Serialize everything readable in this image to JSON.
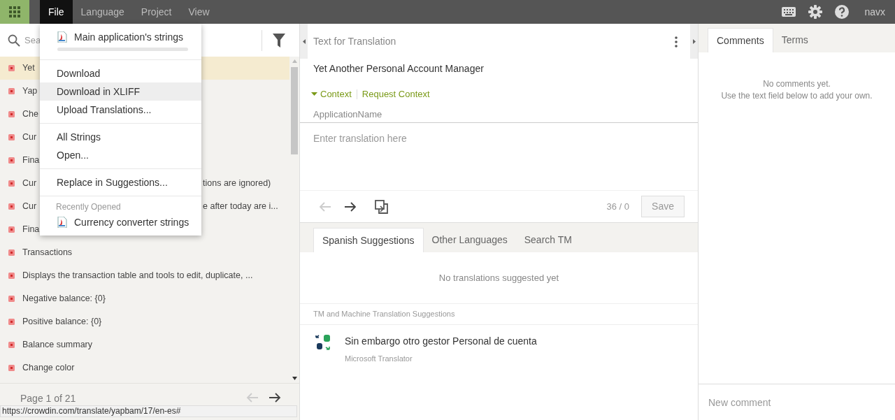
{
  "topbar": {
    "menus": [
      {
        "label": "File",
        "selected": true
      },
      {
        "label": "Language",
        "selected": false
      },
      {
        "label": "Project",
        "selected": false
      },
      {
        "label": "View",
        "selected": false
      }
    ],
    "user": "navx"
  },
  "file_menu": {
    "sections": [
      {
        "items": [
          {
            "kind": "file",
            "label": "Main application's strings",
            "level": 0
          }
        ]
      },
      {
        "items": [
          {
            "kind": "action",
            "label": "Download",
            "highlighted": false
          },
          {
            "kind": "action",
            "label": "Download in XLIFF",
            "highlighted": true
          },
          {
            "kind": "action",
            "label": "Upload Translations...",
            "highlighted": false
          }
        ]
      },
      {
        "items": [
          {
            "kind": "action",
            "label": "All Strings",
            "highlighted": false
          },
          {
            "kind": "action",
            "label": "Open...",
            "highlighted": false
          }
        ]
      },
      {
        "items": [
          {
            "kind": "action",
            "label": "Replace in Suggestions...",
            "highlighted": false
          }
        ]
      },
      {
        "items": [
          {
            "kind": "label",
            "label": "Recently Opened"
          },
          {
            "kind": "file",
            "label": "Currency converter strings"
          }
        ]
      }
    ]
  },
  "strings_panel": {
    "search": {
      "placeholder": "Sea"
    },
    "rows": [
      {
        "text": "Yet",
        "selected": true
      },
      {
        "text": "Yap",
        "selected": false
      },
      {
        "text": "Che",
        "selected": false
      },
      {
        "text": "Cur",
        "selected": false
      },
      {
        "text": "Fina",
        "selected": false
      },
      {
        "text": "Cur",
        "tail": "tions are ignored)",
        "selected": false
      },
      {
        "text": "Cur",
        "tail": "e after today are i...",
        "selected": false
      },
      {
        "text": "Fina",
        "selected": false
      },
      {
        "text": "Transactions",
        "selected": false
      },
      {
        "text": "Displays the transaction table and tools to edit, duplicate, ...",
        "selected": false
      },
      {
        "text": "Negative balance: {0}",
        "selected": false
      },
      {
        "text": "Positive balance: {0}",
        "selected": false
      },
      {
        "text": "Balance summary",
        "selected": false
      },
      {
        "text": "Change color",
        "selected": false
      }
    ],
    "pagination": "Page 1 of 21"
  },
  "editor": {
    "header": "Text for Translation",
    "source": "Yet Another Personal Account Manager",
    "context_toggle": "Context",
    "request_context": "Request Context",
    "context": "ApplicationName",
    "translation": {
      "placeholder": "Enter translation here"
    },
    "counter": "36 / 0",
    "save": "Save"
  },
  "suggestions": {
    "tabs": [
      {
        "label": "Spanish Suggestions",
        "selected": true
      },
      {
        "label": "Other Languages",
        "selected": false
      },
      {
        "label": "Search TM",
        "selected": false
      }
    ],
    "empty": "No translations suggested yet",
    "mt_header": "TM and Machine Translation Suggestions",
    "mt": [
      {
        "text": "Sin embargo otro gestor Personal de cuenta",
        "source": "Microsoft Translator"
      }
    ]
  },
  "side": {
    "tabs": [
      {
        "label": "Comments",
        "selected": true
      },
      {
        "label": "Terms",
        "selected": false
      }
    ],
    "empty": [
      "No comments yet.",
      "Use the text field below to add your own."
    ],
    "new_comment": {
      "placeholder": "New comment"
    }
  },
  "status_url": "https://crowdin.com/translate/yapbam/17/en-es#"
}
